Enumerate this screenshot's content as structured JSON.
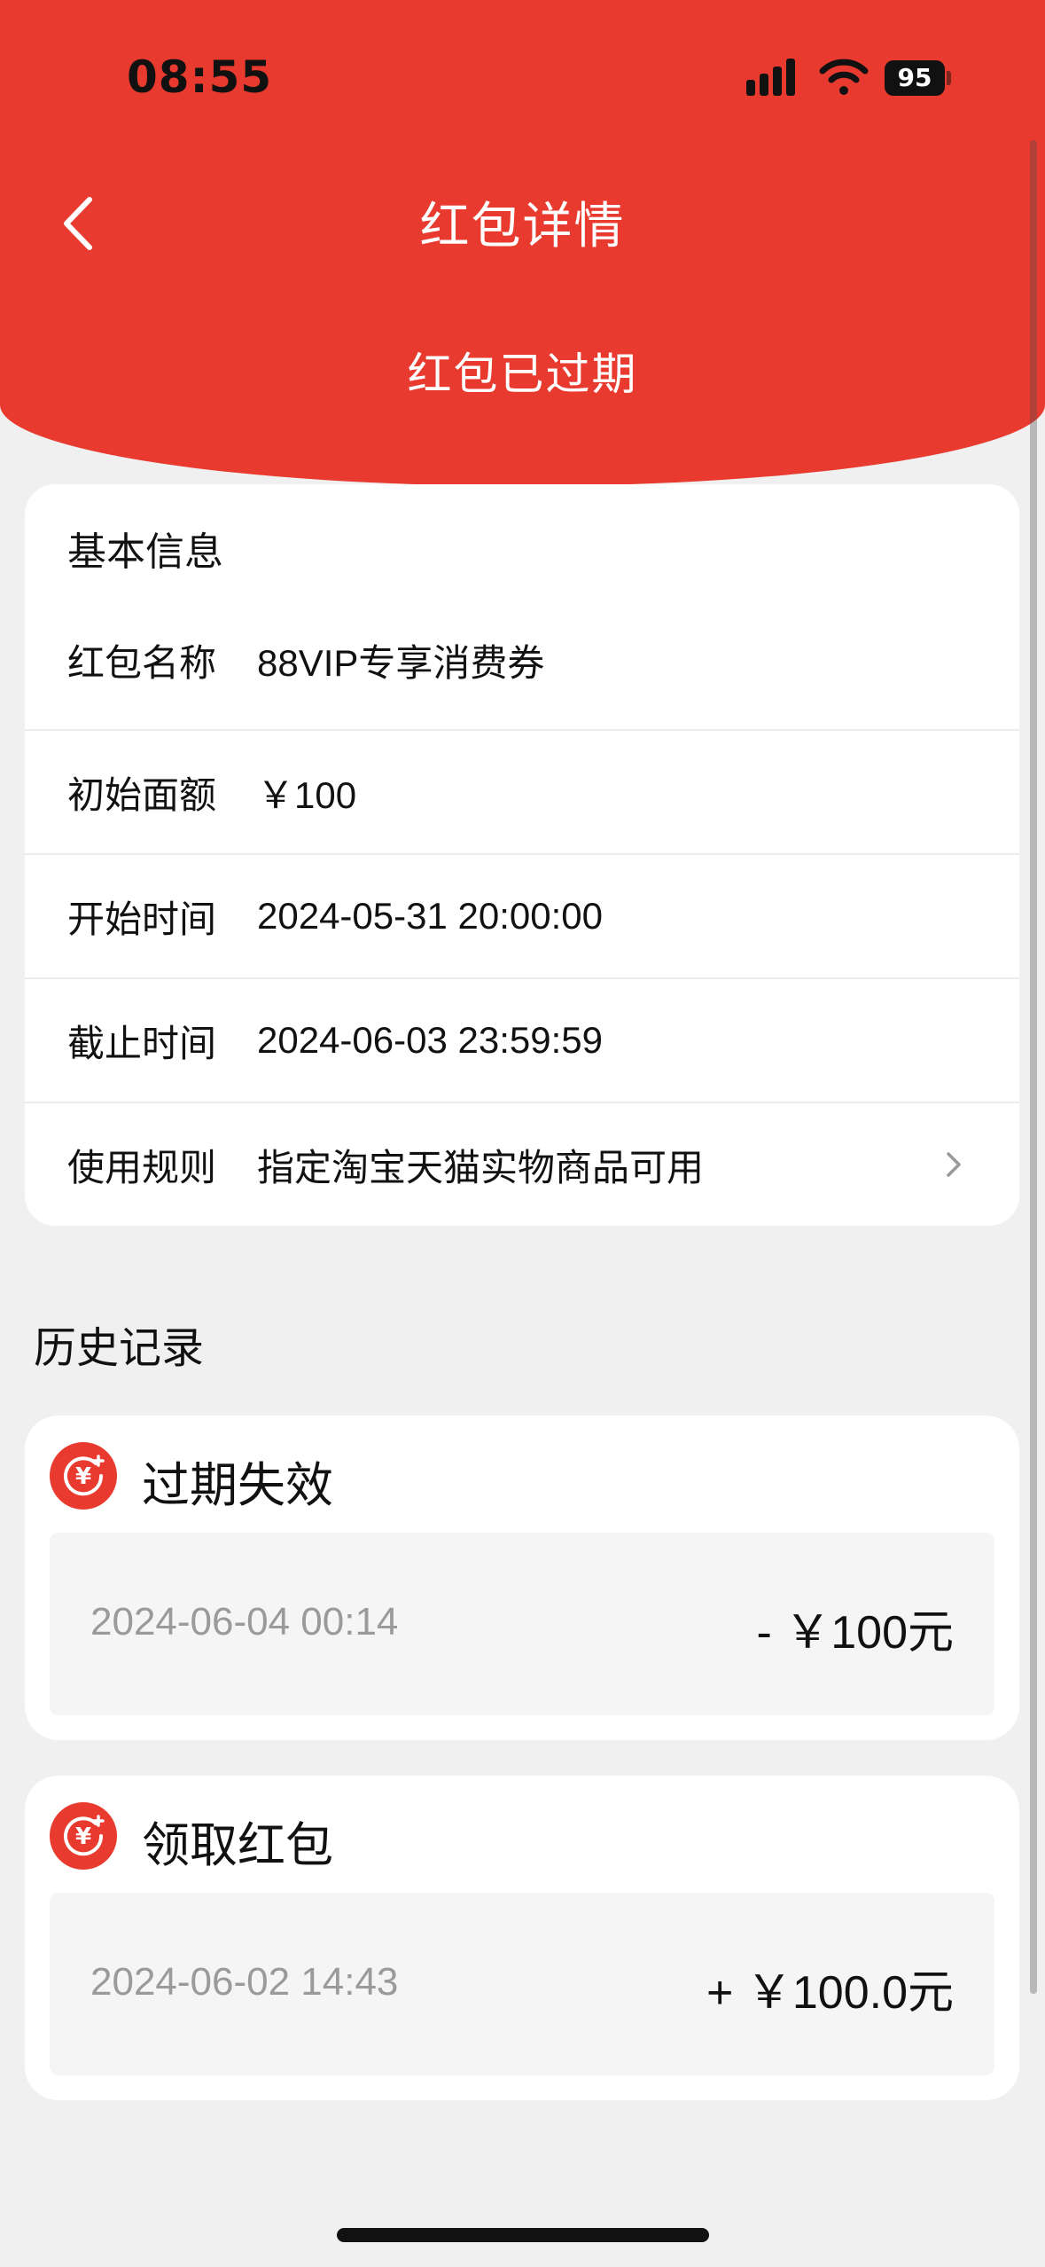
{
  "status_bar": {
    "time": "08:55",
    "battery": "95",
    "icons": [
      "signal-icon",
      "wifi-icon",
      "battery-icon"
    ]
  },
  "nav": {
    "title": "红包详情",
    "back_icon": "chevron-left-icon"
  },
  "header": {
    "status": "红包已过期",
    "color": "#e83a2f"
  },
  "basic_info": {
    "heading": "基本信息",
    "rows": [
      {
        "label": "红包名称",
        "value": "88VIP专享消费券"
      },
      {
        "label": "初始面额",
        "value": "￥100"
      },
      {
        "label": "开始时间",
        "value": "2024-05-31 20:00:00"
      },
      {
        "label": "截止时间",
        "value": "2024-06-03 23:59:59"
      },
      {
        "label": "使用规则",
        "value": "指定淘宝天猫实物商品可用",
        "icon": "chevron-right-icon"
      }
    ]
  },
  "history": {
    "title": "历史记录",
    "records": [
      {
        "type": "过期失效",
        "date": "2024-06-04 00:14",
        "amount": "- ￥100元",
        "icon": "yuan-coin-icon"
      },
      {
        "type": "领取红包",
        "date": "2024-06-02 14:43",
        "amount": "+ ￥100.0元",
        "icon": "yuan-coin-icon"
      }
    ]
  }
}
